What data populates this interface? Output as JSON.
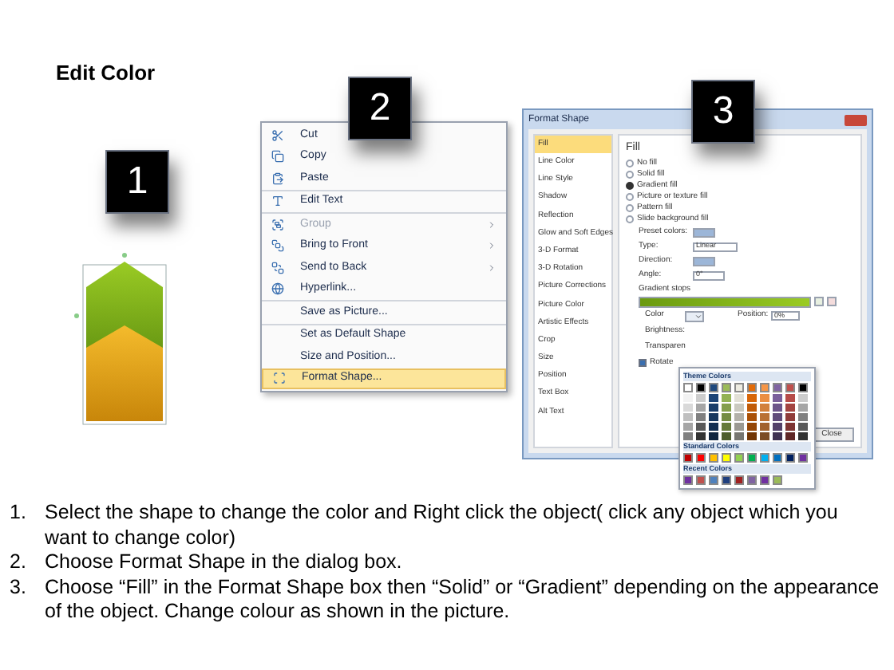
{
  "title": "Edit Color",
  "step_badges": [
    "1",
    "2",
    "3"
  ],
  "context_menu": {
    "groups": [
      [
        {
          "label": "Cut",
          "disabled": false,
          "selected": false,
          "submenu": false
        },
        {
          "label": "Copy",
          "disabled": false,
          "selected": false,
          "submenu": false
        },
        {
          "label": "Paste",
          "disabled": false,
          "selected": false,
          "submenu": false
        }
      ],
      [
        {
          "label": "Edit Text",
          "disabled": false,
          "selected": false,
          "submenu": false
        }
      ],
      [
        {
          "label": "Group",
          "disabled": true,
          "selected": false,
          "submenu": true
        },
        {
          "label": "Bring to Front",
          "disabled": false,
          "selected": false,
          "submenu": true
        },
        {
          "label": "Send to Back",
          "disabled": false,
          "selected": false,
          "submenu": true
        },
        {
          "label": "Hyperlink...",
          "disabled": false,
          "selected": false,
          "submenu": false
        }
      ],
      [
        {
          "label": "Save as Picture...",
          "disabled": false,
          "selected": false,
          "submenu": false
        }
      ],
      [
        {
          "label": "Set as Default Shape",
          "disabled": false,
          "selected": false,
          "submenu": false
        },
        {
          "label": "Size and Position...",
          "disabled": false,
          "selected": false,
          "submenu": false
        },
        {
          "label": "Format Shape...",
          "disabled": false,
          "selected": true,
          "submenu": false
        }
      ]
    ]
  },
  "dialog": {
    "title": "Format Shape",
    "sidebar": [
      {
        "label": "Fill",
        "selected": true
      },
      {
        "label": "Line Color",
        "selected": false
      },
      {
        "label": "Line Style",
        "selected": false
      },
      {
        "label": "Shadow",
        "selected": false
      },
      {
        "label": "Reflection",
        "selected": false
      },
      {
        "label": "Glow and Soft Edges",
        "selected": false
      },
      {
        "label": "3-D Format",
        "selected": false
      },
      {
        "label": "3-D Rotation",
        "selected": false
      },
      {
        "label": "Picture Corrections",
        "selected": false
      },
      {
        "label": "Picture Color",
        "selected": false
      },
      {
        "label": "Artistic Effects",
        "selected": false
      },
      {
        "label": "Crop",
        "selected": false
      },
      {
        "label": "Size",
        "selected": false
      },
      {
        "label": "Position",
        "selected": false
      },
      {
        "label": "Text Box",
        "selected": false
      },
      {
        "label": "Alt Text",
        "selected": false
      }
    ],
    "heading": "Fill",
    "fill_options": [
      {
        "label": "No fill",
        "selected": false
      },
      {
        "label": "Solid fill",
        "selected": false
      },
      {
        "label": "Gradient fill",
        "selected": true
      },
      {
        "label": "Picture or texture fill",
        "selected": false
      },
      {
        "label": "Pattern fill",
        "selected": false
      },
      {
        "label": "Slide background fill",
        "selected": false
      }
    ],
    "preset_colors_label": "Preset colors:",
    "type_label": "Type:",
    "type_value": "Linear",
    "direction_label": "Direction:",
    "angle_label": "Angle:",
    "angle_value": "0°",
    "gradient_stops_label": "Gradient stops",
    "color_label": "Color",
    "position_label": "Position:",
    "position_value": "0%",
    "brightness_label": "Brightness:",
    "transparency_label": "Transparen",
    "rotate": {
      "label": "Rotate",
      "checked": true
    },
    "close_button": "Close"
  },
  "palette": {
    "theme_heading": "Theme Colors",
    "theme_colors": [
      {
        "color": "#ffffff"
      },
      {
        "color": "#000000"
      },
      {
        "color": "#1f497d"
      },
      {
        "color": "#9bbb59"
      },
      {
        "color": "#eeece1"
      },
      {
        "color": "#e36c09"
      },
      {
        "color": "#f79646"
      },
      {
        "color": "#8064a2"
      },
      {
        "color": "#c0504d"
      },
      {
        "color": "#000000"
      }
    ],
    "standard_heading": "Standard Colors",
    "standard_colors": [
      {
        "color": "#c00000"
      },
      {
        "color": "#ff0000"
      },
      {
        "color": "#ffc000"
      },
      {
        "color": "#ffff00"
      },
      {
        "color": "#92d050"
      },
      {
        "color": "#00b050"
      },
      {
        "color": "#00b0f0"
      },
      {
        "color": "#0070c0"
      },
      {
        "color": "#002060"
      },
      {
        "color": "#7030a0"
      }
    ],
    "recent_heading": "Recent Colors",
    "recent_colors": [
      {
        "color": "#7030a0"
      },
      {
        "color": "#c0504d"
      },
      {
        "color": "#4f81bd"
      },
      {
        "color": "#1f3f7f"
      },
      {
        "color": "#a02020"
      },
      {
        "color": "#8064a2"
      },
      {
        "color": "#7030a0"
      },
      {
        "color": "#9bbb59"
      }
    ]
  },
  "instructions": [
    {
      "number": "1.",
      "text": "Select the shape to change the color and Right click the object( click any object which you want to change color)"
    },
    {
      "number": "2.",
      "text": "Choose Format Shape in the dialog box."
    },
    {
      "number": "3.",
      "text": "Choose “Fill” in the Format Shape box then “Solid” or “Gradient” depending on the appearance of the object. Change colour as shown in the picture."
    }
  ]
}
